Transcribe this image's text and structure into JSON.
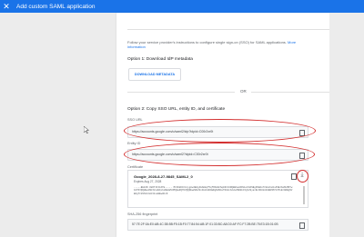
{
  "header": {
    "close_icon": "close-icon",
    "title": "Add custom SAML application"
  },
  "intro": {
    "text": "Follow your service provider's instructions to configure single sign-on (SSO) for SAML applications.",
    "more": "More information"
  },
  "option1": {
    "title": "Option 1: Download IdP metadata",
    "button": "DOWNLOAD METADATA"
  },
  "divider": {
    "text": "OR"
  },
  "option2": {
    "title": "Option 2: Copy SSO URL, entity ID, and certificate",
    "sso": {
      "label": "SSO URL",
      "value": "https://accounts.google.com/o/saml2/idp?idpid=C00r2xr0t"
    },
    "entity": {
      "label": "Entity ID",
      "value": "https://accounts.google.com/o/saml2?idpid=C00r2xr0t"
    },
    "certificate": {
      "label": "Certificate",
      "name": "Google_2028-8-27-9845_SAML2_0",
      "expires": "Expires Aug 27, 2028",
      "text": "-----BEGIN CERTIFICATE----- MIIDdDCCAlygAwIBAgIGAW8qf5qfMA0GCSqGSIb3DQEBCwUAMHsxFDASBgNVBAoTC0dvb2dsZSBJbmMuMRYwFAYDVQQHEw1Nb3VudGFpbiBWaWV3MQ8wDQYDVQQDEwZHb29nbGUxGDAWBgNVBAsTD0dvb2dsZSBGb3IgV29yazELMAkGA1UEBhMCVVMxEzARBgNVBAgTCkNhbGlmb3JuaWEwHhcN"
    },
    "fingerprint": {
      "label": "SHA-256 fingerprint",
      "value": "57:7E:2F:0A:E0:AB:4C:3B:5B:F5:1B:F0:77:84:54:AB:1F:01:33:BC:A8:D0:AF:FC:F7:2B:BE:75:E3:1B:01:0B"
    }
  },
  "annotations": {
    "color": "#d32f2f"
  }
}
